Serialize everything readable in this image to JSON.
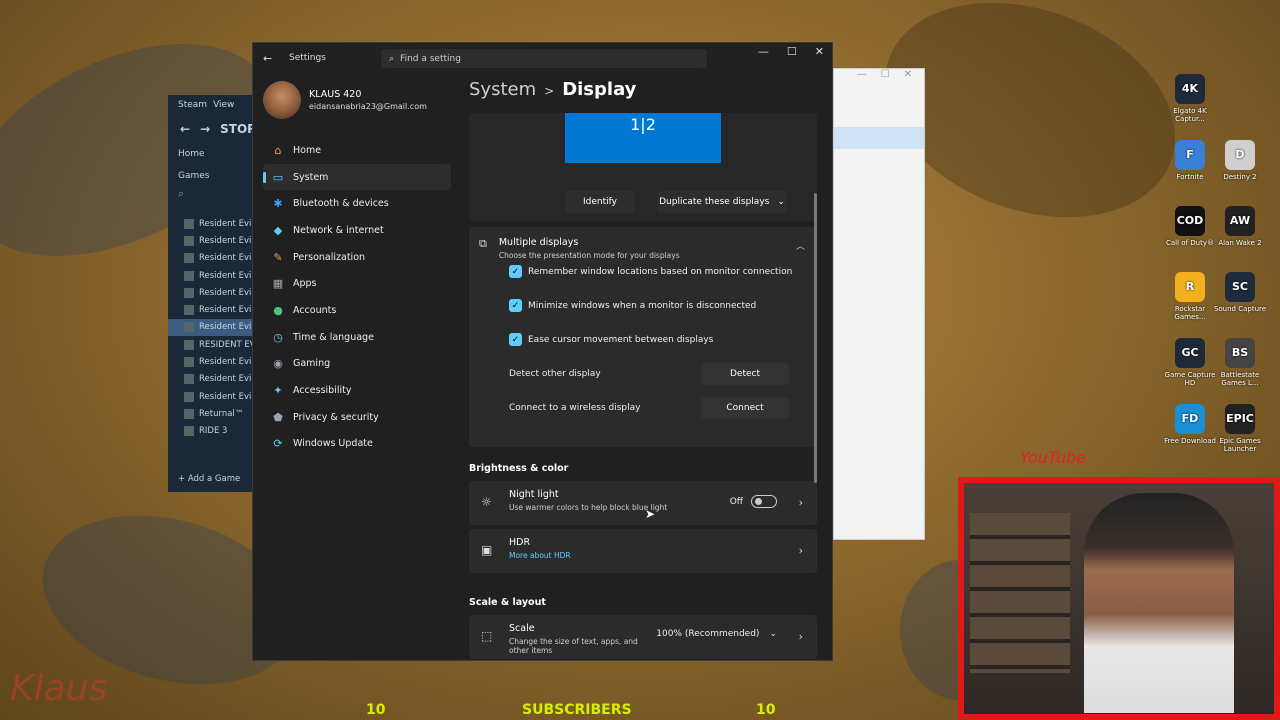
{
  "steam": {
    "title": "Steam",
    "menu_view": "View",
    "store_label": "STOR",
    "home": "Home",
    "games": "Games",
    "games_list": [
      "Resident Evil",
      "Resident Evil",
      "Resident Evil",
      "Resident Evil",
      "Resident Evil",
      "Resident Evil",
      "Resident Evil",
      "RESIDENT EV",
      "Resident Evil",
      "Resident Evil",
      "Resident Evil",
      "Returnal™",
      "RIDE 3"
    ],
    "selected_index": 6,
    "add_game": "Add a Game"
  },
  "settings": {
    "app_title": "Settings",
    "search_placeholder": "Find a setting",
    "profile": {
      "name": "KLAUS 420",
      "email": "eidansanabria23@Gmail.com"
    },
    "nav": [
      {
        "label": "Home",
        "icon": "home-icon",
        "glyph": "⌂",
        "color": "#e8a25a"
      },
      {
        "label": "System",
        "icon": "system-icon",
        "glyph": "▭",
        "color": "#60cdff",
        "active": true
      },
      {
        "label": "Bluetooth & devices",
        "icon": "bluetooth-icon",
        "glyph": "✱",
        "color": "#3b9bff"
      },
      {
        "label": "Network & internet",
        "icon": "network-icon",
        "glyph": "◆",
        "color": "#60cdff"
      },
      {
        "label": "Personalization",
        "icon": "brush-icon",
        "glyph": "✎",
        "color": "#e8a25a"
      },
      {
        "label": "Apps",
        "icon": "apps-icon",
        "glyph": "▦",
        "color": "#9aa4b0"
      },
      {
        "label": "Accounts",
        "icon": "accounts-icon",
        "glyph": "●",
        "color": "#4ec27a"
      },
      {
        "label": "Time & language",
        "icon": "clock-icon",
        "glyph": "◷",
        "color": "#60cdff"
      },
      {
        "label": "Gaming",
        "icon": "gaming-icon",
        "glyph": "◉",
        "color": "#9aa4b0"
      },
      {
        "label": "Accessibility",
        "icon": "accessibility-icon",
        "glyph": "✦",
        "color": "#60cdff"
      },
      {
        "label": "Privacy & security",
        "icon": "shield-icon",
        "glyph": "⬟",
        "color": "#9aa4b0"
      },
      {
        "label": "Windows Update",
        "icon": "update-icon",
        "glyph": "⟳",
        "color": "#60cdff"
      }
    ],
    "breadcrumb": {
      "parent": "System",
      "separator": ">",
      "current": "Display"
    },
    "monitor_label": "1|2",
    "identify": "Identify",
    "duplicate": "Duplicate these displays",
    "multiple_displays": {
      "title": "Multiple displays",
      "subtitle": "Choose the presentation mode for your displays",
      "checks": [
        "Remember window locations based on monitor connection",
        "Minimize windows when a monitor is disconnected",
        "Ease cursor movement between displays"
      ],
      "detect_label": "Detect other display",
      "detect_button": "Detect",
      "connect_label": "Connect to a wireless display",
      "connect_button": "Connect"
    },
    "brightness_heading": "Brightness & color",
    "night_light": {
      "title": "Night light",
      "subtitle": "Use warmer colors to help block blue light",
      "state": "Off"
    },
    "hdr": {
      "title": "HDR",
      "link": "More about HDR"
    },
    "scale_heading": "Scale & layout",
    "scale": {
      "title": "Scale",
      "subtitle": "Change the size of text, apps, and other items",
      "value": "100% (Recommended)"
    }
  },
  "desktop_icons": [
    {
      "label": "Elgato 4K Captur...",
      "badge": "4K",
      "color": "#1e2a3a"
    },
    {
      "label": "Fortnite",
      "badge": "F",
      "color": "#3a7fd6"
    },
    {
      "label": "Destiny 2",
      "badge": "D",
      "color": "#cfcfcf"
    },
    {
      "label": "Call of Duty®",
      "badge": "COD",
      "color": "#111111"
    },
    {
      "label": "Alan Wake 2",
      "badge": "AW",
      "color": "#222222"
    },
    {
      "label": "Rockstar Games...",
      "badge": "R",
      "color": "#f2b01e"
    },
    {
      "label": "Sound Capture",
      "badge": "SC",
      "color": "#1e2a3a"
    },
    {
      "label": "Game Capture HD",
      "badge": "GC",
      "color": "#1e2a3a"
    },
    {
      "label": "Battlestate Games L...",
      "badge": "BS",
      "color": "#444444"
    },
    {
      "label": "Free Download",
      "badge": "FD",
      "color": "#1a8fd6"
    },
    {
      "label": "Epic Games Launcher",
      "badge": "EPIC",
      "color": "#222222"
    }
  ],
  "stream_overlay": {
    "left_count": "10",
    "center": "SUBSCRIBERS",
    "right_count": "10",
    "youtube": "YouTube",
    "signature": "Klaus"
  }
}
